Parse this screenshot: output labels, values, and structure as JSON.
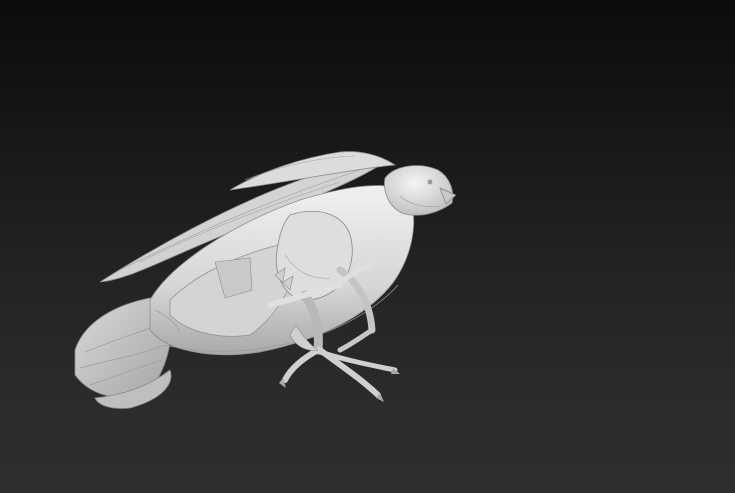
{
  "viewport": {
    "background_top": "#0c0c0c",
    "background_bottom": "#2e2e2e",
    "model_color": "#d9d9d9",
    "model_shadow": "#9a9a9a",
    "model_highlight": "#f2f2f2"
  },
  "model": {
    "subject": "bird-model",
    "shading": "clay-grey"
  }
}
